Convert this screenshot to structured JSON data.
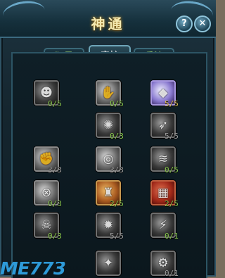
{
  "window": {
    "title": "神通"
  },
  "buttons": {
    "help": "?",
    "close": "✕"
  },
  "tabs": [
    {
      "label": "狂暴",
      "active": false
    },
    {
      "label": "守护",
      "active": true
    },
    {
      "label": "兵法",
      "active": false
    }
  ],
  "skills": [
    {
      "level": "0/5",
      "icon": "face-icon",
      "color_hex": "#8ac850"
    },
    {
      "level": "0/5",
      "icon": "claw-icon",
      "color_hex": "#8ac850"
    },
    {
      "level": "5/5",
      "icon": "crystal-icon",
      "color_hex": "#e0c050"
    },
    {
      "level": "0/3",
      "icon": "spin-icon",
      "color_hex": "#8ac850"
    },
    {
      "level": "5/5",
      "icon": "strike-icon",
      "color_hex": "#a0a0a0"
    },
    {
      "level": "3/3",
      "icon": "fist-icon",
      "color_hex": "#a0a0a0"
    },
    {
      "level": "3/3",
      "icon": "shield-ring-icon",
      "color_hex": "#a0a0a0"
    },
    {
      "level": "0/5",
      "icon": "slash-icon",
      "color_hex": "#8ac850"
    },
    {
      "level": "0/3",
      "icon": "net-orb-icon",
      "color_hex": "#8ac850"
    },
    {
      "level": "2/5",
      "icon": "armor-icon",
      "color_hex": "#8ac850"
    },
    {
      "level": "2/5",
      "icon": "fire-gate-icon",
      "color_hex": "#8ac850"
    },
    {
      "level": "0/3",
      "icon": "skull-icon",
      "color_hex": "#8ac850"
    },
    {
      "level": "5/5",
      "icon": "burst-icon",
      "color_hex": "#a0a0a0"
    },
    {
      "level": "0/1",
      "icon": "beam-icon",
      "color_hex": "#8ac850"
    },
    {
      "level": "",
      "icon": "light-icon",
      "color_hex": "#a0a0a0"
    },
    {
      "level": "0/1",
      "icon": "gear-icon",
      "color_hex": "#a0a0a0"
    }
  ],
  "watermark": {
    "text": "ME773"
  }
}
